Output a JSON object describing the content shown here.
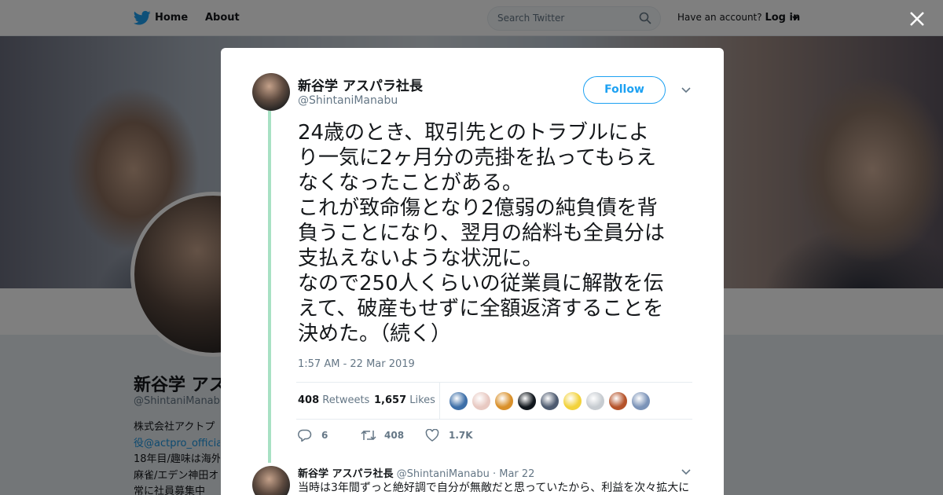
{
  "topbar": {
    "home_label": "Home",
    "about_label": "About",
    "search_placeholder": "Search Twitter",
    "have_account": "Have an account?",
    "login_label": "Log in"
  },
  "background_profile": {
    "name": "新谷学 アス",
    "handle": "@ShintaniManabu",
    "bio_lines": [
      "株式会社アクトプ",
      "役@actpro_officia",
      "18年目/趣味は海外",
      "麻雀/エデン神田オ",
      "常に社員募集中"
    ]
  },
  "tweet": {
    "author_name": "新谷学 アスパラ社長",
    "author_handle": "@ShintaniManabu",
    "follow_label": "Follow",
    "text": "24歳のとき、取引先とのトラブルによ\nり一気に2ヶ月分の売掛を払ってもらえ\nなくなったことがある。\nこれが致命傷となり2億弱の純負債を背\n負うことになり、翌月の給料も全員分は\n支払えないような状況に。\nなので250人くらいの従業員に解散を伝\nえて、破産もせずに全額返済することを\n決めた。（続く）",
    "timestamp": "1:57 AM - 22 Mar 2019",
    "retweets_count": "408",
    "retweets_label": "Retweets",
    "likes_count": "1,657",
    "likes_label": "Likes",
    "reply_action_count": "6",
    "retweet_action_count": "408",
    "like_action_count": "1.7K",
    "liker_colors": [
      "#3d6fa8",
      "#e8c9c2",
      "#d9902a",
      "#10161c",
      "#4e5b70",
      "#f2d23b",
      "#c7ccd1",
      "#b5532a",
      "#7b93b8"
    ]
  },
  "reply": {
    "author_name": "新谷学 アスパラ社長",
    "author_handle": "@ShintaniManabu",
    "separator": "·",
    "date": "Mar 22",
    "text": "当時は3年間ずっと絶好調で自分が無敵だと思っていたから、利益を次々拡大に"
  },
  "colors": {
    "accent": "#1da1f2",
    "thread_line": "#a8e1c4",
    "muted_text": "#657786"
  }
}
